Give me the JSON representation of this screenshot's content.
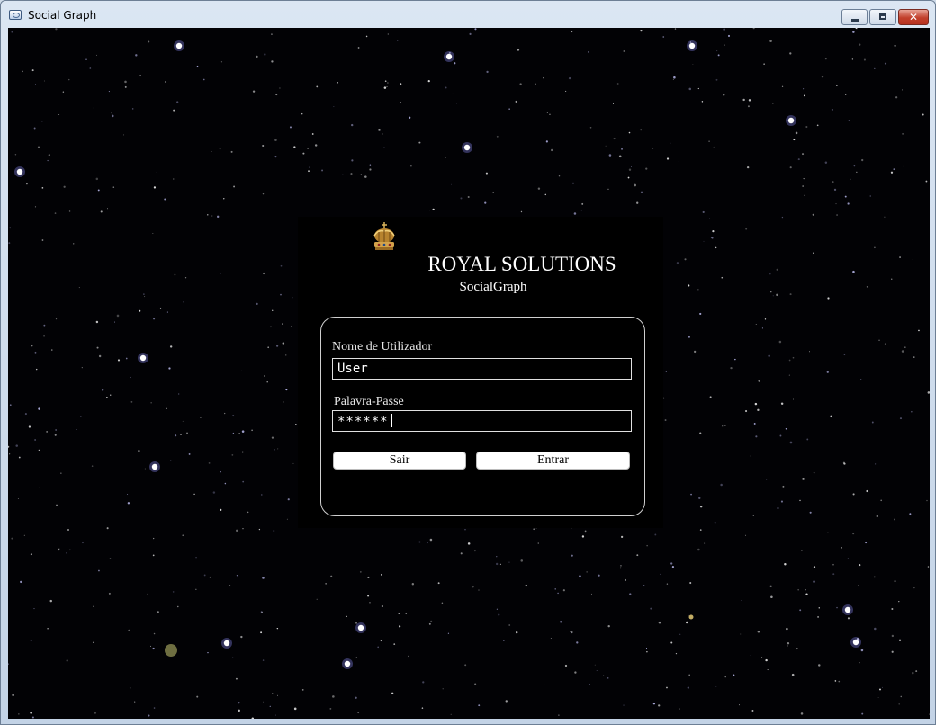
{
  "window": {
    "title": "Social Graph",
    "controls": {
      "minimize": "minimize-icon",
      "maximize": "maximize-icon",
      "close": "✕"
    }
  },
  "branding": {
    "company": "ROYAL SOLUTIONS",
    "product": "SocialGraph",
    "logo": "crown-icon"
  },
  "login": {
    "username_label": "Nome de Utilizador",
    "username_value": "User",
    "password_label": "Palavra-Passe",
    "password_mask": "******",
    "exit_button": "Sair",
    "enter_button": "Entrar"
  },
  "colors": {
    "background": "#020205",
    "panel": "#000000",
    "text": "#ffffff",
    "crown_gold": "#d4a24a"
  }
}
